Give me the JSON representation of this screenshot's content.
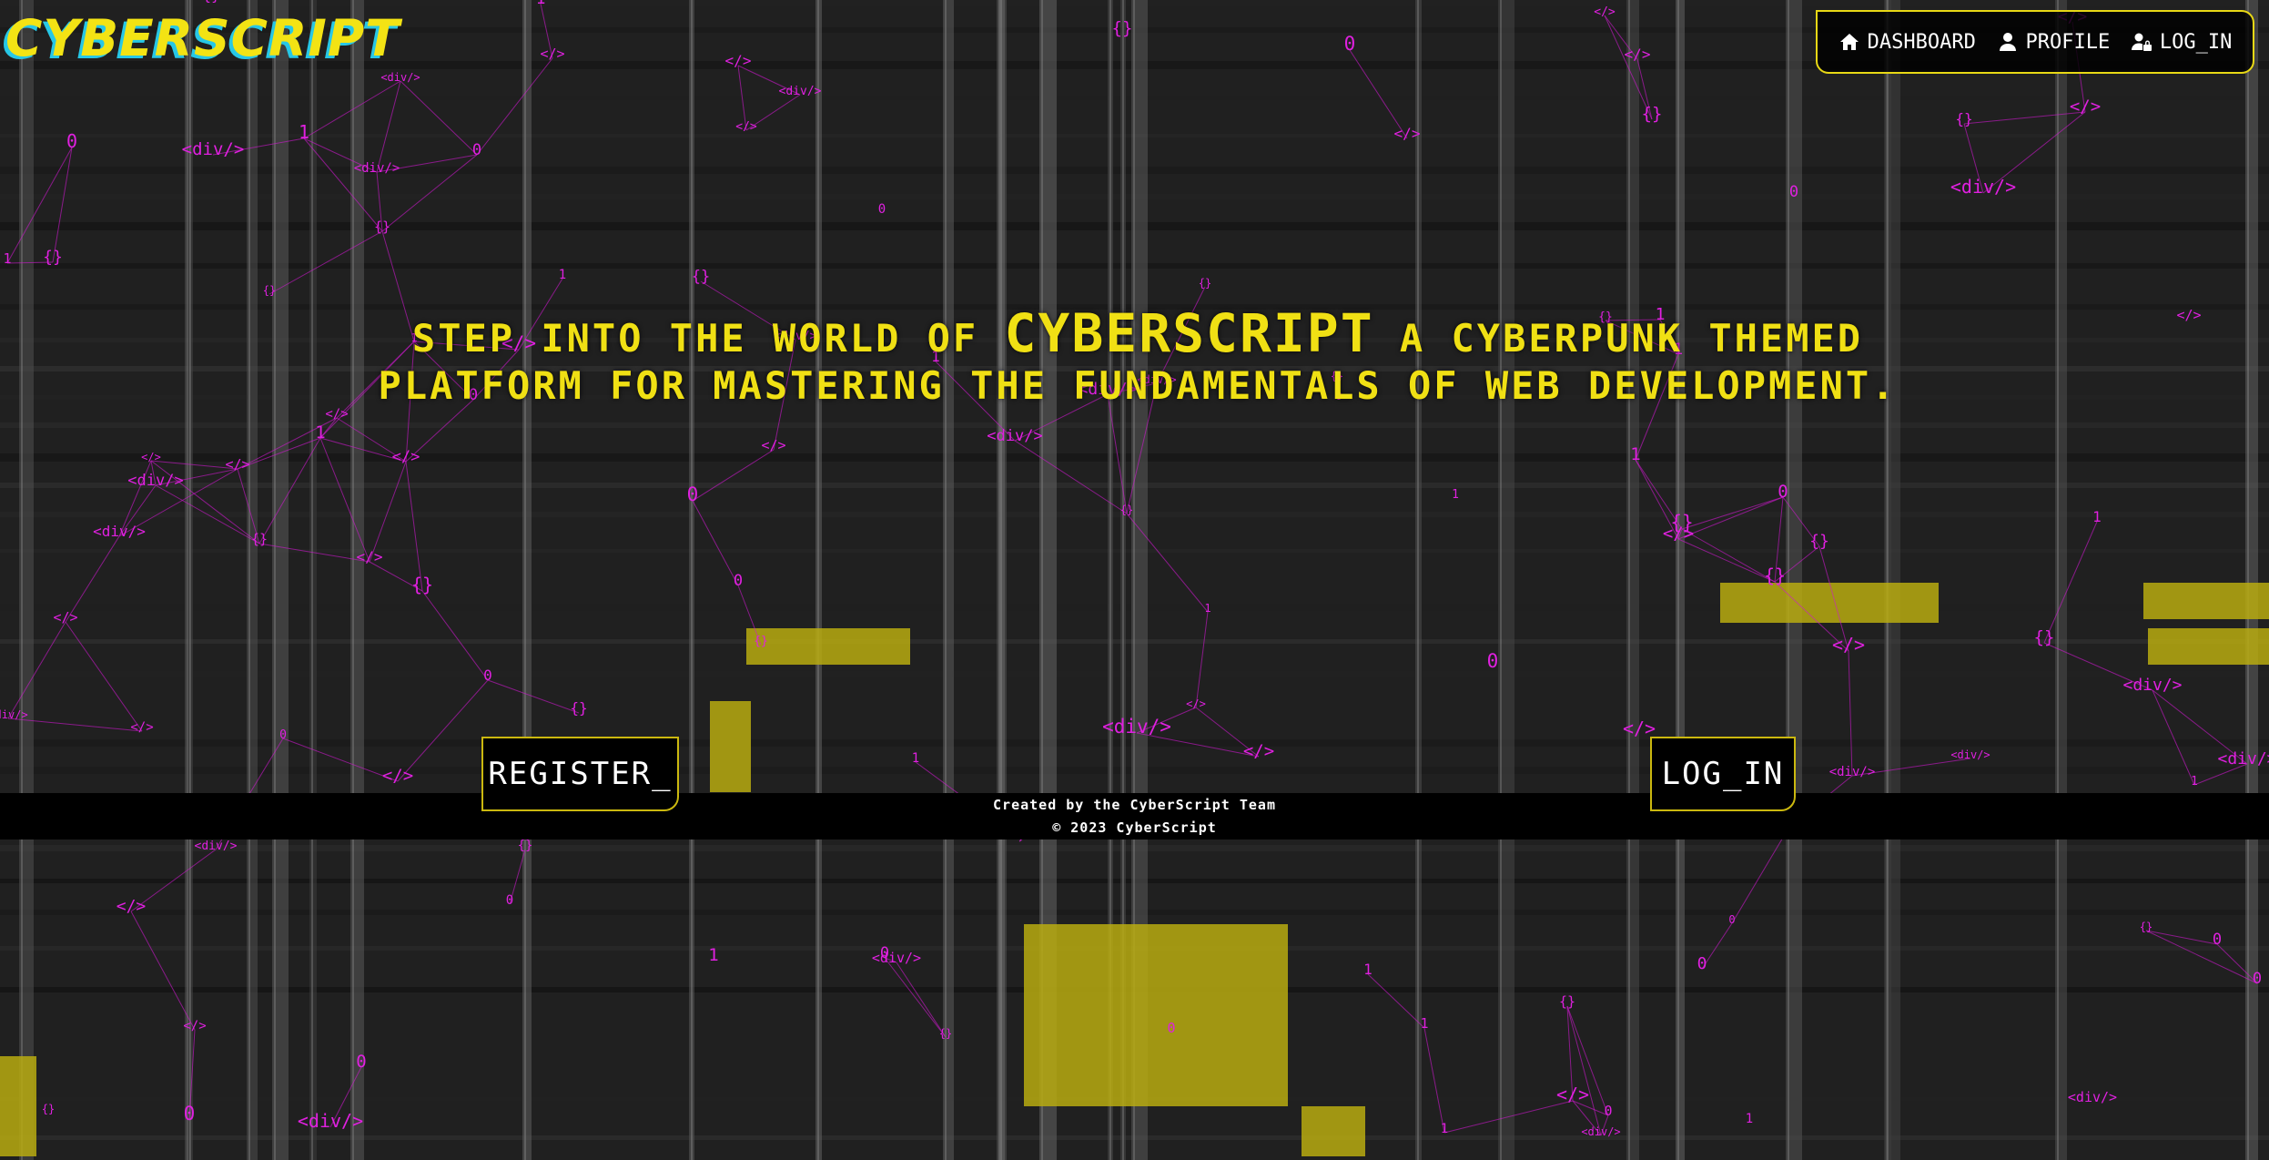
{
  "brand": {
    "logo_text": "CYBERSCRIPT"
  },
  "nav": {
    "items": [
      {
        "label": "DASHBOARD",
        "icon": "home-icon"
      },
      {
        "label": "PROFILE",
        "icon": "user-icon"
      },
      {
        "label": "LOG_IN",
        "icon": "user-lock-icon"
      }
    ]
  },
  "hero": {
    "intro": "STEP INTO THE WORLD OF",
    "highlight": "CYBERSCRIPT",
    "line1_rest": "A CYBERPUNK THEMED",
    "line2": "PLATFORM FOR MASTERING THE FUNDAMENTALS OF WEB DEVELOPMENT."
  },
  "buttons": {
    "register_label": "REGISTER_",
    "login_label": "LOG_IN"
  },
  "footer": {
    "credit": "Created by the CyberScript Team",
    "copyright": "© 2023 CyberScript"
  },
  "background_tokens": [
    "<div/>",
    "</>",
    "{}",
    "0",
    "1"
  ],
  "colors": {
    "accent_yellow": "#f0e014",
    "logo_shadow_cyan": "#27c7e6",
    "particle_magenta": "#e020e0",
    "panel_black": "#000000"
  }
}
